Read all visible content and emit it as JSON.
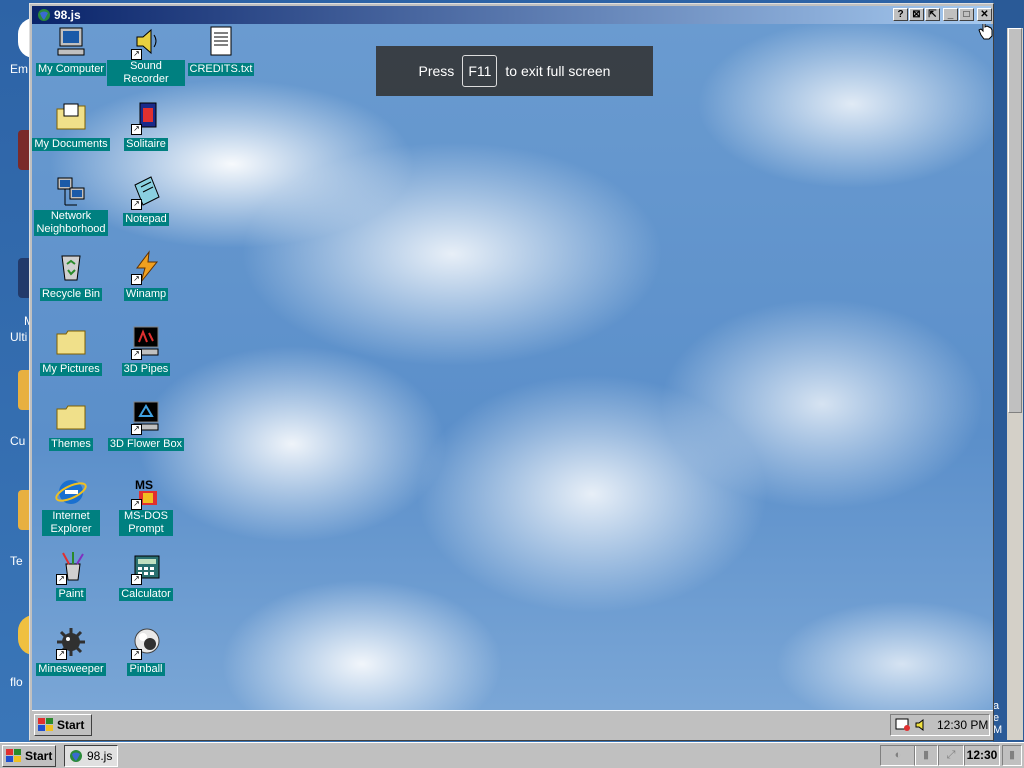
{
  "window": {
    "title": "98.js",
    "buttons": {
      "help": "?",
      "a": "⊠",
      "b": "⇱",
      "minimize": "_",
      "maximize": "□",
      "close": "✕"
    }
  },
  "fullscreen_notice": {
    "prefix": "Press",
    "key": "F11",
    "suffix": "to exit full screen"
  },
  "host_desktop": {
    "labels": [
      "Em",
      "",
      "M",
      "Ulti",
      "Cu",
      "Te",
      "flo"
    ],
    "right_text": [
      "a",
      "e",
      "M"
    ]
  },
  "desktop_icons": [
    {
      "label": "My Computer",
      "icon": "my-computer-icon"
    },
    {
      "label": "Sound Recorder",
      "icon": "sound-recorder-icon"
    },
    {
      "label": "CREDITS.txt",
      "icon": "text-file-icon"
    },
    {
      "label": "My Documents",
      "icon": "folder-documents-icon"
    },
    {
      "label": "Solitaire",
      "icon": "solitaire-icon"
    },
    {
      "label": "Network Neighborhood",
      "icon": "network-icon"
    },
    {
      "label": "Notepad",
      "icon": "notepad-icon"
    },
    {
      "label": "Recycle Bin",
      "icon": "recycle-bin-icon"
    },
    {
      "label": "Winamp",
      "icon": "winamp-icon"
    },
    {
      "label": "My Pictures",
      "icon": "folder-icon"
    },
    {
      "label": "3D Pipes",
      "icon": "screensaver-icon"
    },
    {
      "label": "Themes",
      "icon": "folder-icon"
    },
    {
      "label": "3D Flower Box",
      "icon": "screensaver-icon"
    },
    {
      "label": "Internet Explorer",
      "icon": "internet-explorer-icon"
    },
    {
      "label": "MS-DOS Prompt",
      "icon": "ms-dos-icon"
    },
    {
      "label": "Paint",
      "icon": "paint-icon"
    },
    {
      "label": "Calculator",
      "icon": "calculator-icon"
    },
    {
      "label": "Minesweeper",
      "icon": "minesweeper-icon"
    },
    {
      "label": "Pinball",
      "icon": "pinball-icon"
    }
  ],
  "guest_taskbar": {
    "start_label": "Start",
    "clock": "12:30 PM"
  },
  "host_taskbar": {
    "start_label": "Start",
    "task_label": "98.js",
    "clock": "12:30"
  }
}
